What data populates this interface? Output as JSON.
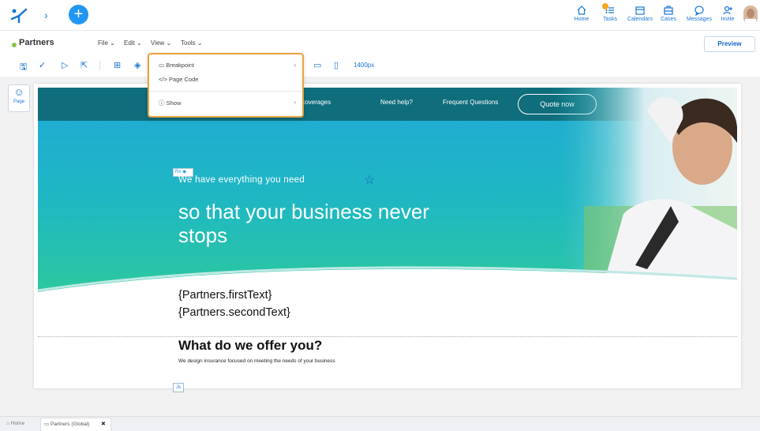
{
  "nav": {
    "items": [
      {
        "label": "Home",
        "icon": "home-icon"
      },
      {
        "label": "Tasks",
        "icon": "tasks-icon"
      },
      {
        "label": "Calendars",
        "icon": "calendar-icon"
      },
      {
        "label": "Cases",
        "icon": "cases-icon"
      },
      {
        "label": "Messages",
        "icon": "messages-icon"
      },
      {
        "label": "Invite",
        "icon": "invite-icon"
      }
    ],
    "accent": "#2196f3",
    "badge_color": "#f5a623"
  },
  "page": {
    "title": "Partners",
    "menus": [
      "File",
      "Edit",
      "View",
      "Tools"
    ],
    "preview_label": "Preview",
    "width_label": "1400px",
    "page_button_label": "Page"
  },
  "view_menu": {
    "items": [
      {
        "label": "Breakpoint",
        "has_submenu": true
      },
      {
        "label": "Page Code",
        "has_submenu": false
      },
      {
        "label": "Show",
        "has_submenu": true
      }
    ]
  },
  "canvas": {
    "nav_links": [
      "ur coverages",
      "Need help?",
      "Frequent Questions"
    ],
    "quote_button": "Quote now",
    "rx_tag": "Rx",
    "hero_small": "We have everything you need",
    "hero_big": "so that your business never stops",
    "first_text": "{Partners.firstText}",
    "second_text": "{Partners.secondText}",
    "offer_title": "What do we offer you?",
    "offer_sub": "We design insurance focused on meeting the needs of your business",
    "js_tag": "Js"
  },
  "statusbar": {
    "home": "Home",
    "tab_label": "Partners (Global)",
    "close": "✖"
  }
}
